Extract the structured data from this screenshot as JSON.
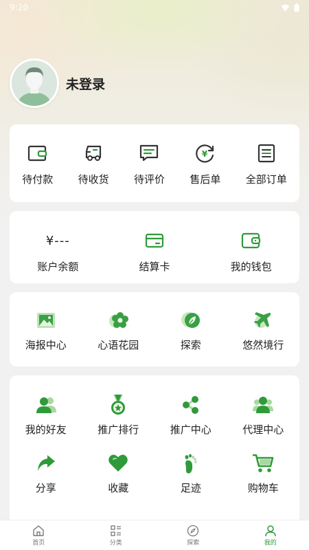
{
  "status_bar": {
    "time": "9:20"
  },
  "profile": {
    "name": "未登录"
  },
  "orders": {
    "items": [
      {
        "label": "待付款",
        "icon": "wallet-icon"
      },
      {
        "label": "待收货",
        "icon": "truck-icon"
      },
      {
        "label": "待评价",
        "icon": "comment-icon"
      },
      {
        "label": "售后单",
        "icon": "yen-refresh-icon"
      },
      {
        "label": "全部订单",
        "icon": "order-list-icon"
      }
    ]
  },
  "finance": {
    "balance_value": "¥---",
    "balance_label": "账户余额",
    "card_label": "结算卡",
    "wallet_label": "我的钱包"
  },
  "services": {
    "items": [
      {
        "label": "海报中心",
        "icon": "poster-icon"
      },
      {
        "label": "心语花园",
        "icon": "flower-icon"
      },
      {
        "label": "探索",
        "icon": "leaf-icon"
      },
      {
        "label": "悠然境行",
        "icon": "airplane-icon"
      }
    ]
  },
  "tools": {
    "items": [
      {
        "label": "我的好友",
        "icon": "friends-icon"
      },
      {
        "label": "推广排行",
        "icon": "medal-icon"
      },
      {
        "label": "推广中心",
        "icon": "share-nodes-icon"
      },
      {
        "label": "代理中心",
        "icon": "agent-icon"
      },
      {
        "label": "分享",
        "icon": "share-arrow-icon"
      },
      {
        "label": "收藏",
        "icon": "heart-icon"
      },
      {
        "label": "足迹",
        "icon": "footprint-icon"
      },
      {
        "label": "购物车",
        "icon": "cart-icon"
      }
    ]
  },
  "bottom_nav": {
    "items": [
      {
        "label": "首页",
        "icon": "home-icon"
      },
      {
        "label": "分类",
        "icon": "category-icon"
      },
      {
        "label": "探索",
        "icon": "compass-icon"
      },
      {
        "label": "我的",
        "icon": "user-icon"
      }
    ],
    "active": "我的"
  },
  "colors": {
    "accent": "#2f9a3a",
    "icon_gray": "#333333"
  }
}
